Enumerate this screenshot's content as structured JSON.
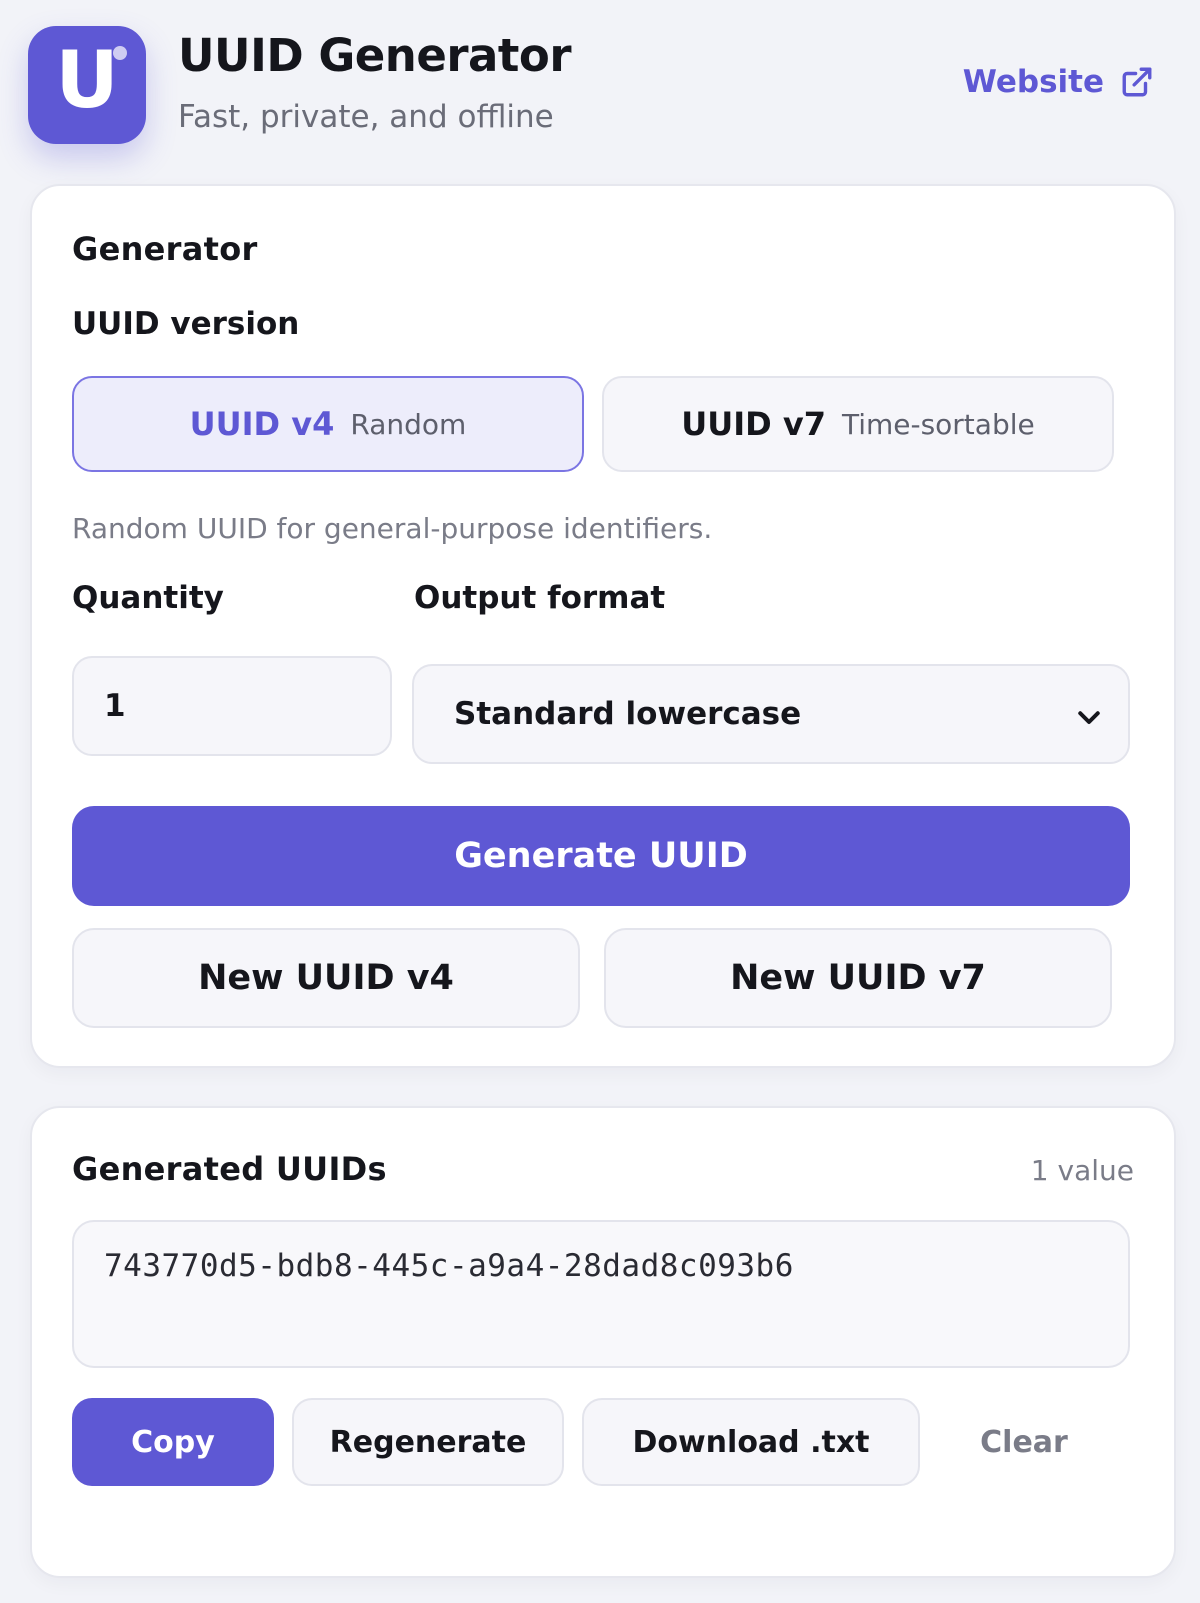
{
  "header": {
    "logo_letter": "U",
    "title": "UUID Generator",
    "subtitle": "Fast, private, and offline",
    "website_label": "Website",
    "website_icon": "external-link-icon"
  },
  "generator": {
    "title": "Generator",
    "version_label": "UUID version",
    "versions": [
      {
        "name": "UUID v4",
        "desc": "Random",
        "selected": true
      },
      {
        "name": "UUID v7",
        "desc": "Time-sortable",
        "selected": false
      }
    ],
    "help_text": "Random UUID for general-purpose identifiers.",
    "quantity_label": "Quantity",
    "quantity_value": "1",
    "format_label": "Output format",
    "format_value": "Standard lowercase",
    "generate_label": "Generate UUID",
    "new_v4_label": "New UUID v4",
    "new_v7_label": "New UUID v7"
  },
  "results": {
    "title": "Generated UUIDs",
    "count_label": "1 value",
    "uuids": [
      "743770d5-bdb8-445c-a9a4-28dad8c093b6"
    ],
    "copy_label": "Copy",
    "regenerate_label": "Regenerate",
    "download_label": "Download .txt",
    "clear_label": "Clear"
  },
  "colors": {
    "accent": "#5e58d4",
    "page_background": "#f2f3f8",
    "card_background": "#ffffff",
    "muted_text": "#7a7c88"
  }
}
